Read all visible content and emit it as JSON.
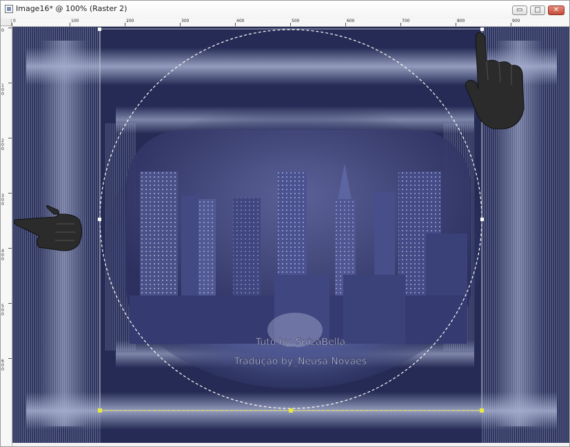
{
  "window": {
    "title": "Image16* @ 100% (Raster 2)",
    "controls": {
      "minimize": "▭",
      "maximize": "□",
      "close": "✕"
    }
  },
  "ruler": {
    "horizontal_labels": [
      "0",
      "100",
      "200",
      "300",
      "400",
      "500",
      "600",
      "700",
      "800",
      "900"
    ],
    "vertical_labels": [
      "0",
      "100",
      "200",
      "300",
      "400",
      "500",
      "600"
    ]
  },
  "canvas": {
    "watermark_line1": "Tuto by_SuizaBella",
    "watermark_line2": "Tradução by_Neusa Novaes",
    "colors": {
      "background": "#252b55",
      "band": "#a7b0d0",
      "selection_marquee": "#ffffff",
      "layer_bounds": "#e8e840"
    },
    "icons": {
      "pointing_hand_right": "hand-pointing-right-icon",
      "pointing_hand_up": "hand-pointing-up-icon"
    }
  }
}
